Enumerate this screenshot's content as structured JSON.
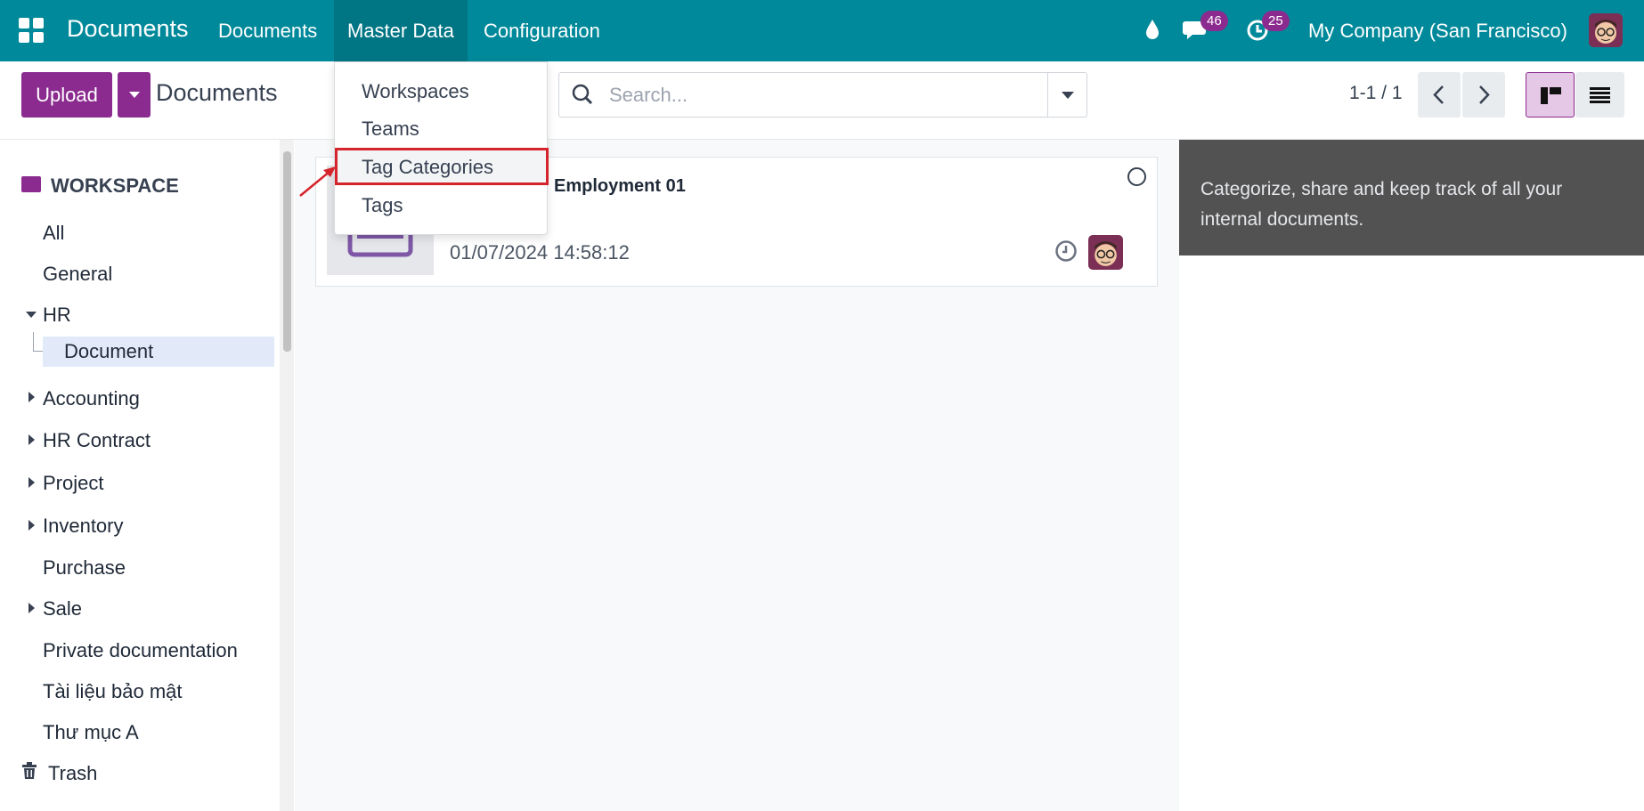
{
  "navbar": {
    "brand": "Documents",
    "menu": [
      "Documents",
      "Master Data",
      "Configuration"
    ],
    "chat_badge": "46",
    "activity_badge": "25",
    "company": "My Company (San Francisco)"
  },
  "control_panel": {
    "upload_label": "Upload",
    "title": "Documents",
    "search_placeholder": "Search...",
    "pager": "1-1 / 1"
  },
  "dropdown": {
    "items": [
      "Workspaces",
      "Teams",
      "Tag Categories",
      "Tags"
    ],
    "highlighted": "Tag Categories"
  },
  "sidebar": {
    "header": "WORKSPACE",
    "items": [
      "All",
      "General",
      "HR",
      "Document",
      "Accounting",
      "HR Contract",
      "Project",
      "Inventory",
      "Purchase",
      "Sale",
      "Private documentation",
      "Tài liệu bảo mật",
      "Thư mục A"
    ],
    "trash": "Trash"
  },
  "document_card": {
    "title": "Employment 01",
    "date": "01/07/2024 14:58:12"
  },
  "info_panel": {
    "text": "Categorize, share and keep track of all your internal documents."
  },
  "colors": {
    "navbar": "#00899a",
    "primary": "#8b2b8f",
    "highlight_border": "#d6242c"
  }
}
